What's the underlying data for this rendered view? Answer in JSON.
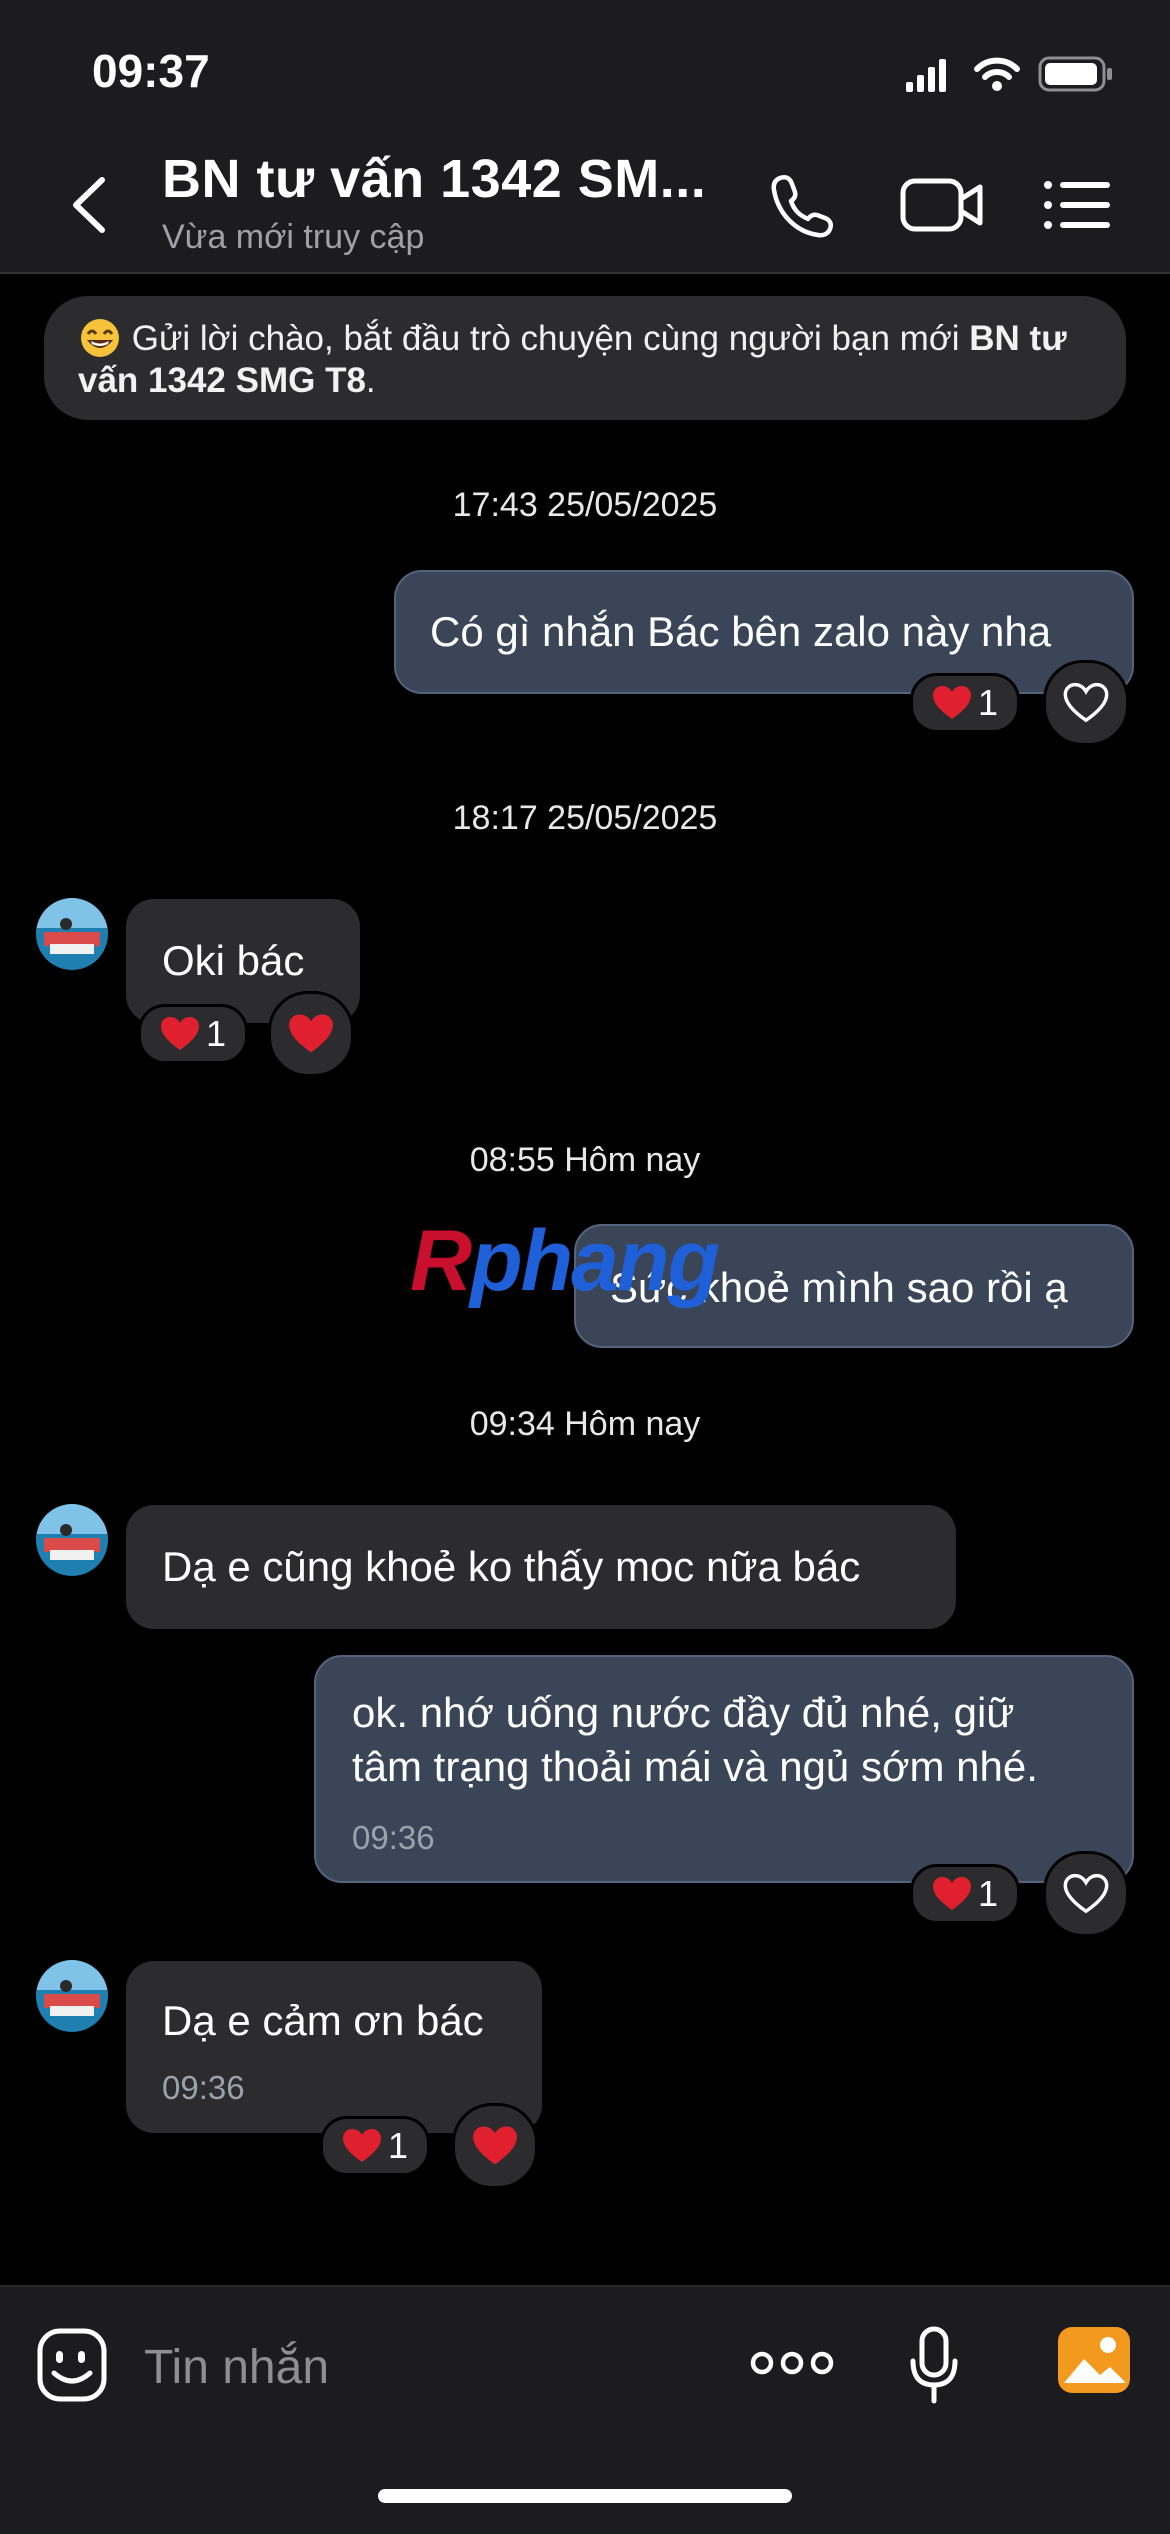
{
  "status_bar": {
    "time": "09:37"
  },
  "header": {
    "title": "BN tư vấn 1342 SM...",
    "subtitle": "Vừa mới truy cập"
  },
  "greeting": {
    "text_before": "Gửi lời chào, bắt đầu trò chuyện cùng người bạn mới ",
    "contact_name": "BN tư vấn 1342 SMG T8",
    "text_after": "."
  },
  "timestamps": [
    "17:43 25/05/2025",
    "18:17 25/05/2025",
    "08:55 Hôm nay",
    "09:34 Hôm nay"
  ],
  "messages": [
    {
      "direction": "out",
      "text": "Có gì nhắn Bác bên zalo này nha",
      "reaction_count": "1"
    },
    {
      "direction": "in",
      "text": "Oki bác",
      "reaction_count": "1"
    },
    {
      "direction": "out",
      "text": "Sức khoẻ mình sao rồi ạ"
    },
    {
      "direction": "in",
      "text": "Dạ e cũng khoẻ ko thấy moc nữa bác"
    },
    {
      "direction": "out",
      "lines": [
        "ok. nhớ uống nước đầy đủ nhé, giữ",
        "tâm trạng thoải mái và ngủ sớm nhé."
      ],
      "time": "09:36",
      "reaction_count": "1"
    },
    {
      "direction": "in",
      "text": "Dạ e cảm ơn bác",
      "time": "09:36",
      "reaction_count": "1"
    }
  ],
  "watermark": {
    "part1": "R",
    "part2": "phang"
  },
  "composer": {
    "placeholder": "Tin nhắn"
  },
  "colors": {
    "header_bg": "#1c1c1e",
    "outgoing_bubble": "#3a4658",
    "incoming_bubble": "#2c2c2e",
    "heart": "#e0202f",
    "image_button": "#f39a1e"
  },
  "icons": [
    "back-chevron",
    "phone",
    "video-camera",
    "list-menu",
    "emoji-face",
    "more-dots",
    "microphone",
    "image",
    "heart-outline",
    "heart-filled"
  ]
}
